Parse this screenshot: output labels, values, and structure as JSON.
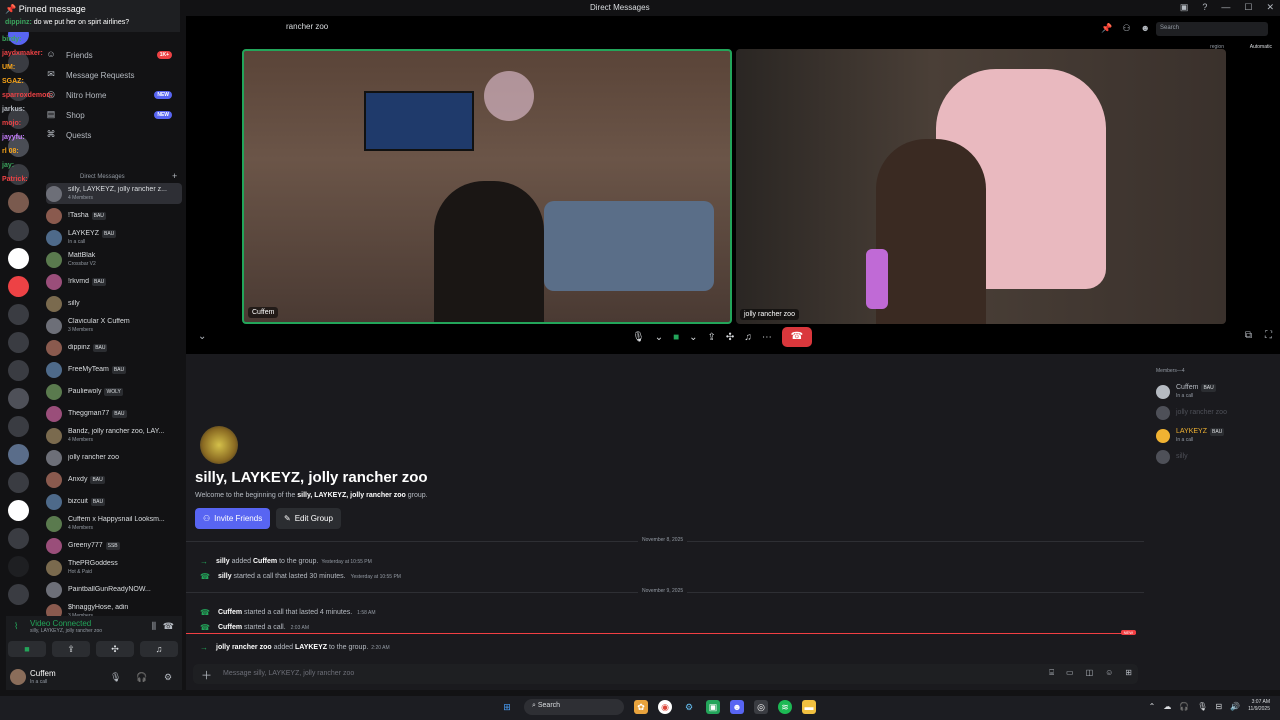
{
  "window": {
    "title": "Direct Messages"
  },
  "pinned": {
    "header": "Pinned message",
    "author": "dippinz:",
    "text": "do we put her on spirt airlines?"
  },
  "chat_overlay": [
    {
      "text": "birdy:",
      "color": "#3ba55d"
    },
    {
      "text": "jaydxmaker:",
      "color": "#ed4245"
    },
    {
      "text": "UM:",
      "color": "#faa61a"
    },
    {
      "text": "SGAZ:",
      "color": "#faa61a"
    },
    {
      "text": "sparroxdemon:",
      "color": "#ed4245"
    },
    {
      "text": "jarkus:",
      "color": "#b5bac1"
    },
    {
      "text": "mojo:",
      "color": "#ed4245"
    },
    {
      "text": "jayyfu:",
      "color": "#c77dff"
    },
    {
      "text": "rl 08:",
      "color": "#faa61a"
    },
    {
      "text": "jay:",
      "color": "#3ba55d"
    },
    {
      "text": "Patrick:",
      "color": "#ed4245"
    }
  ],
  "sidebar": {
    "nav": [
      {
        "label": "Friends",
        "badge": "1K+"
      },
      {
        "label": "Message Requests",
        "badge": ""
      },
      {
        "label": "Nitro Home",
        "badge": "NEW"
      },
      {
        "label": "Shop",
        "badge": "NEW"
      },
      {
        "label": "Quests",
        "badge": ""
      }
    ],
    "dm_header": "Direct Messages",
    "add_icon": "+",
    "dms": [
      {
        "name": "silly, LAYKEYZ, jolly rancher z...",
        "sub": "4 Members",
        "tag": ""
      },
      {
        "name": "!Tasha",
        "sub": "",
        "tag": "BAU"
      },
      {
        "name": "LAYKEYZ",
        "sub": "In a call",
        "tag": "BAU"
      },
      {
        "name": "MattBlak",
        "sub": "Crossbar V2",
        "tag": ""
      },
      {
        "name": "!rkvmd",
        "sub": "",
        "tag": "BAU"
      },
      {
        "name": "silly",
        "sub": "",
        "tag": ""
      },
      {
        "name": "Clavicular X Cuffem",
        "sub": "3 Members",
        "tag": ""
      },
      {
        "name": "dippinz",
        "sub": "",
        "tag": "BAU"
      },
      {
        "name": "FreeMyTeam",
        "sub": "",
        "tag": "BAU"
      },
      {
        "name": "Pauliewoly",
        "sub": "",
        "tag": "WOLY"
      },
      {
        "name": "Theggman77",
        "sub": "",
        "tag": "BAU"
      },
      {
        "name": "Bandz, jolly rancher zoo, LAY...",
        "sub": "4 Members",
        "tag": ""
      },
      {
        "name": "jolly rancher zoo",
        "sub": "",
        "tag": ""
      },
      {
        "name": "Anxdy",
        "sub": "",
        "tag": "BAU"
      },
      {
        "name": "bizcuit",
        "sub": "",
        "tag": "BAU"
      },
      {
        "name": "Cuffem x Happysnail Looksm...",
        "sub": "4 Members",
        "tag": ""
      },
      {
        "name": "Greeny777",
        "sub": "",
        "tag": "SSB"
      },
      {
        "name": "ThePRGoddess",
        "sub": "Hot & Paid",
        "tag": ""
      },
      {
        "name": "PaintballGunReadyNOW...",
        "sub": "",
        "tag": ""
      },
      {
        "name": "$hnaggyHose, adin",
        "sub": "3 Members",
        "tag": ""
      }
    ]
  },
  "voice": {
    "status": "Video Connected",
    "channel": "silly, LAYKEYZ, jolly rancher zoo"
  },
  "user": {
    "name": "Cuffem",
    "status": "In a call"
  },
  "call": {
    "header": "rancher zoo",
    "search_placeholder": "Search",
    "region": "region",
    "region_value": "Automatic",
    "tiles": [
      {
        "name": "Cuffem"
      },
      {
        "name": "jolly rancher zoo"
      }
    ]
  },
  "members": {
    "header": "Members—4",
    "list": [
      {
        "name": "Cuffem",
        "tag": "BAU",
        "sub": "In a call",
        "color": "#b5bac1"
      },
      {
        "name": "jolly rancher zoo",
        "tag": "",
        "sub": "",
        "color": "#4e5058"
      },
      {
        "name": "LAYKEYZ",
        "tag": "BAU",
        "sub": "In a call",
        "color": "#f0b232"
      },
      {
        "name": "silly",
        "tag": "",
        "sub": "",
        "color": "#4e5058"
      }
    ]
  },
  "chat": {
    "title": "silly, LAYKEYZ, jolly rancher zoo",
    "welcome_pre": "Welcome to the beginning of the",
    "welcome_group": "silly, LAYKEYZ, jolly rancher zoo",
    "welcome_post": "group.",
    "invite_label": "Invite Friends",
    "edit_label": "Edit Group",
    "date1": "November 8, 2025",
    "date2": "November 9, 2025",
    "messages": [
      {
        "actor": "silly",
        "action": "added",
        "target": "Cuffem",
        "rest": "to the group.",
        "time": "Yesterday at 10:55 PM"
      },
      {
        "actor": "silly",
        "action": "started a call that lasted 30 minutes.",
        "target": "",
        "rest": "",
        "time": "Yesterday at 10:55 PM"
      },
      {
        "actor": "Cuffem",
        "action": "started a call that lasted 4 minutes.",
        "target": "",
        "rest": "",
        "time": "1:58 AM"
      },
      {
        "actor": "Cuffem",
        "action": "started a call.",
        "target": "",
        "rest": "",
        "time": "2:03 AM"
      },
      {
        "actor": "jolly rancher zoo",
        "action": "added",
        "target": "LAYKEYZ",
        "rest": "to the group.",
        "time": "2:20 AM"
      }
    ],
    "new_label": "NEW",
    "input_placeholder": "Message silly, LAYKEYZ, jolly rancher zoo"
  },
  "taskbar": {
    "search": "Search",
    "time": "3:07 AM",
    "date": "11/9/2025"
  }
}
